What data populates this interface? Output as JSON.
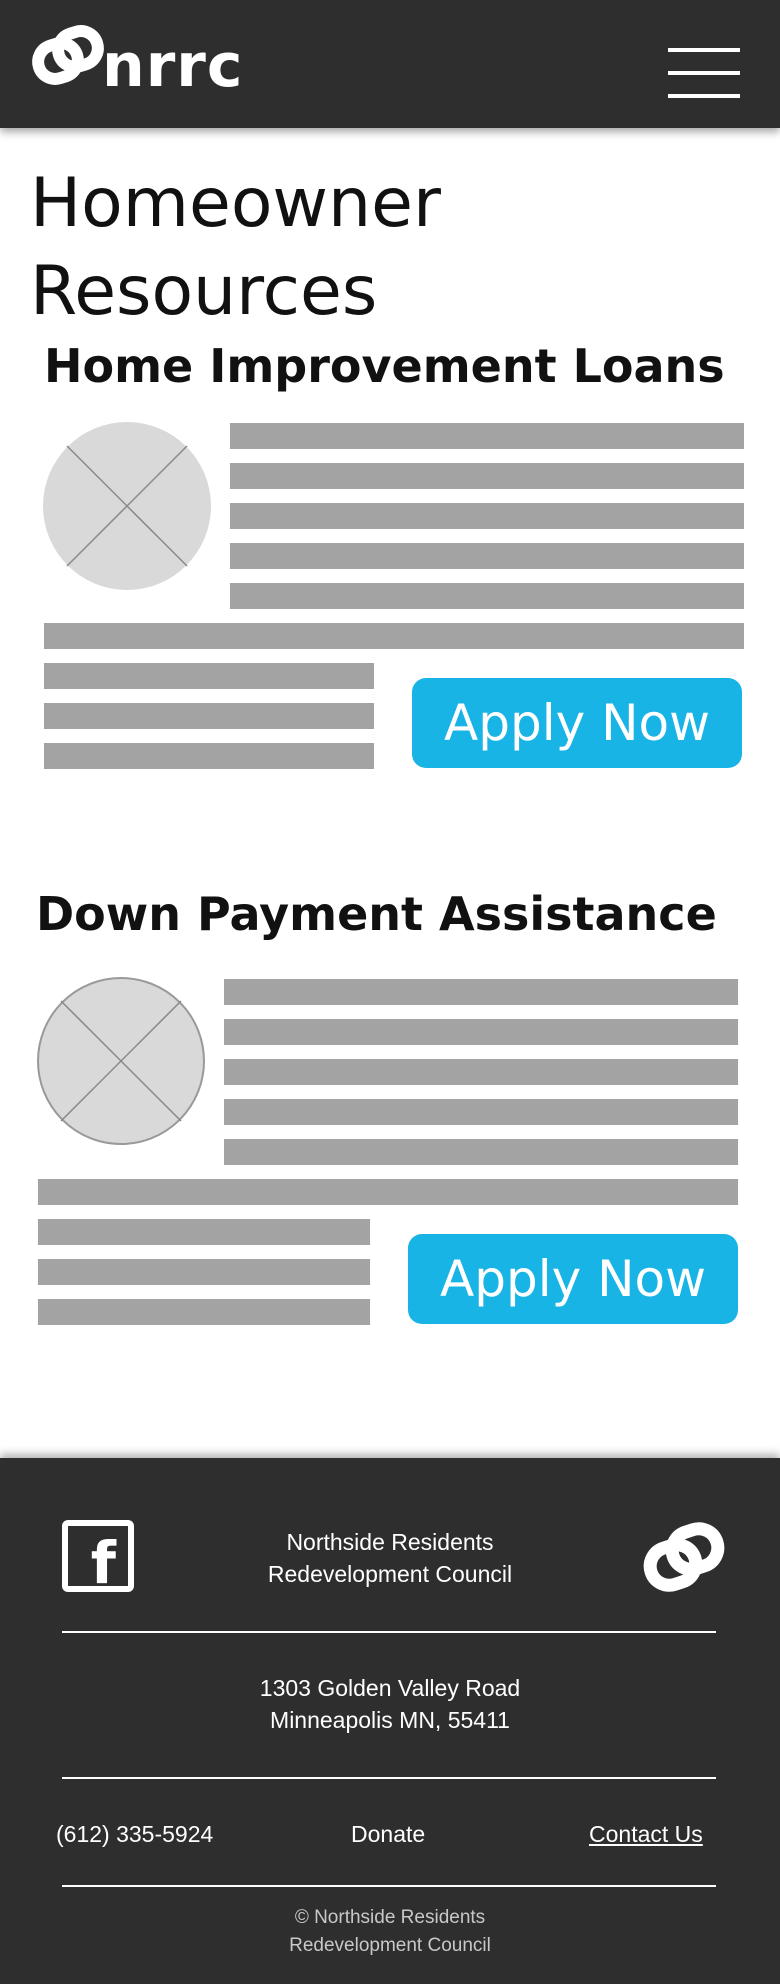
{
  "header": {
    "logo_text": "nrrc",
    "menu_icon": "hamburger-menu-icon"
  },
  "main": {
    "title_line1": "Homeowner",
    "title_line2": "Resources",
    "sections": [
      {
        "title": "Home Improvement Loans",
        "button_label": "Apply Now",
        "image_icon": "image-placeholder-icon"
      },
      {
        "title": "Down Payment Assistance",
        "button_label": "Apply Now",
        "image_icon": "image-placeholder-icon"
      }
    ]
  },
  "footer": {
    "social_icon": "facebook-icon",
    "org_name_line1": "Northside Residents",
    "org_name_line2": "Redevelopment Council",
    "address_line1": "1303 Golden Valley Road",
    "address_line2": "Minneapolis MN, 55411",
    "phone": "(612) 335-5924",
    "donate_label": "Donate",
    "contact_label": "Contact Us",
    "copyright_line1": "© Northside Residents",
    "copyright_line2": "Redevelopment Council",
    "logo_icon": "chain-link-logo-icon"
  },
  "colors": {
    "header_bg": "#2e2e2e",
    "accent": "#18b4e6",
    "text_placeholder": "#a3a3a3",
    "image_placeholder": "#d9d9d9"
  }
}
